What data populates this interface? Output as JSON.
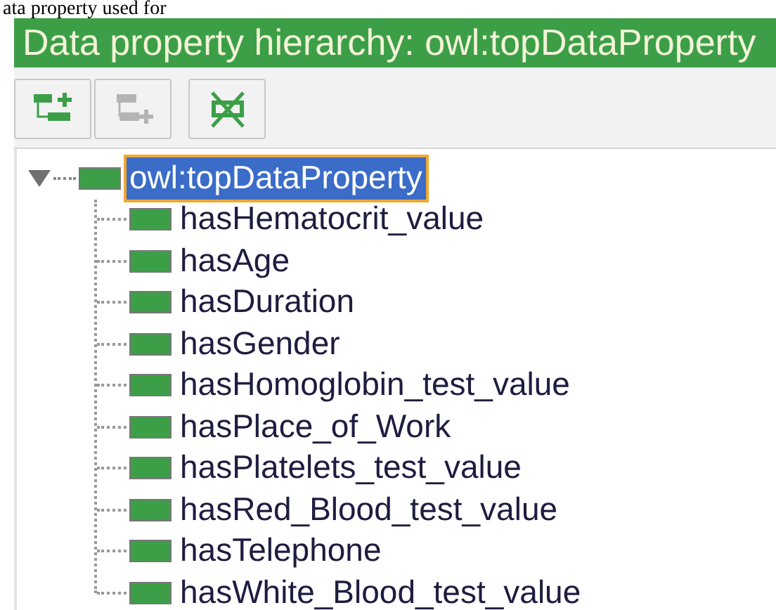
{
  "caption_fragment": "ata property used for",
  "panel": {
    "title": "Data property hierarchy: owl:topDataProperty"
  },
  "toolbar": [
    {
      "kind": "add-sub",
      "disabled": false
    },
    {
      "kind": "add-sibling",
      "disabled": true
    },
    {
      "kind": "delete",
      "disabled": false
    }
  ],
  "tree": {
    "label": "owl:topDataProperty",
    "selected": true,
    "expanded": true,
    "children": [
      {
        "label": "hasHematocrit_value",
        "selected": false
      },
      {
        "label": "hasAge",
        "selected": false
      },
      {
        "label": "hasDuration",
        "selected": false
      },
      {
        "label": "hasGender",
        "selected": false
      },
      {
        "label": "hasHomoglobin_test_value",
        "selected": false
      },
      {
        "label": "hasPlace_of_Work",
        "selected": false
      },
      {
        "label": "hasPlatelets_test_value",
        "selected": false
      },
      {
        "label": "hasRed_Blood_test_value",
        "selected": false
      },
      {
        "label": "hasTelephone",
        "selected": false
      },
      {
        "label": "hasWhite_Blood_test_value",
        "selected": false
      }
    ]
  }
}
